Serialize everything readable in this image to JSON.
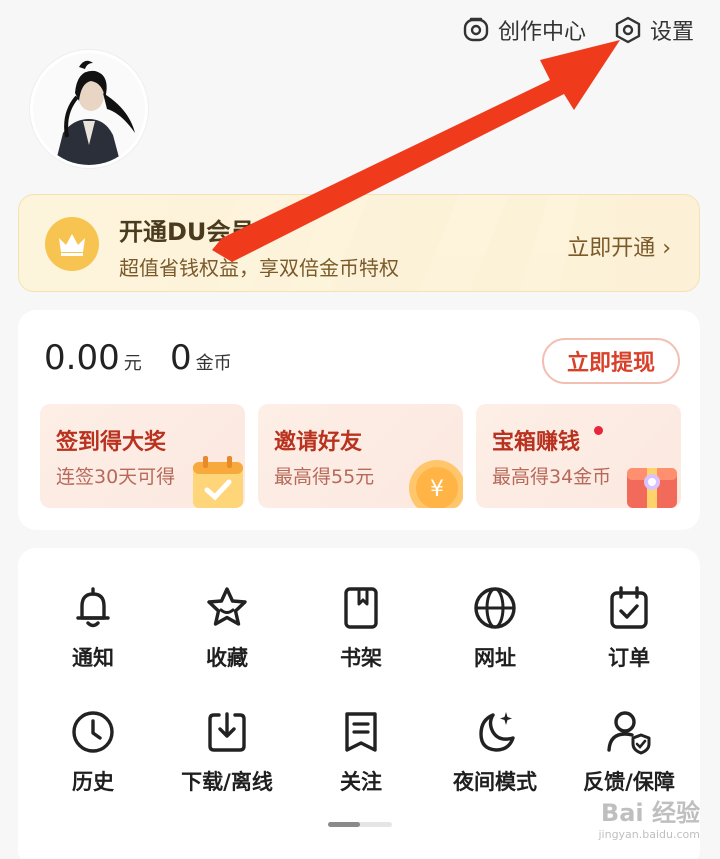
{
  "header": {
    "creation_center": "创作中心",
    "settings": "设置"
  },
  "vip": {
    "title": "开通DU会员",
    "subtitle": "超值省钱权益，享双倍金币特权",
    "action": "立即开通 ›"
  },
  "wallet": {
    "cash_value": "0.00",
    "cash_unit": "元",
    "coin_value": "0",
    "coin_unit": "金币",
    "withdraw_label": "立即提现"
  },
  "tasks": [
    {
      "title": "签到得大奖",
      "subtitle": "连签30天可得"
    },
    {
      "title": "邀请好友",
      "subtitle": "最高得55元"
    },
    {
      "title": "宝箱赚钱",
      "subtitle": "最高得34金币"
    }
  ],
  "grid": [
    {
      "label": "通知",
      "icon": "bell-icon"
    },
    {
      "label": "收藏",
      "icon": "star-icon"
    },
    {
      "label": "书架",
      "icon": "bookshelf-icon"
    },
    {
      "label": "网址",
      "icon": "globe-icon"
    },
    {
      "label": "订单",
      "icon": "order-icon"
    },
    {
      "label": "历史",
      "icon": "clock-icon"
    },
    {
      "label": "下载/离线",
      "icon": "download-icon"
    },
    {
      "label": "关注",
      "icon": "follow-icon"
    },
    {
      "label": "夜间模式",
      "icon": "moon-icon"
    },
    {
      "label": "反馈/保障",
      "icon": "feedback-icon"
    }
  ],
  "watermark": {
    "brand": "Bai 经验",
    "url": "jingyan.baidu.com"
  },
  "colors": {
    "accent_red": "#d9402a",
    "vip_gold": "#f7c452",
    "annotation_arrow": "#f03a1c"
  }
}
